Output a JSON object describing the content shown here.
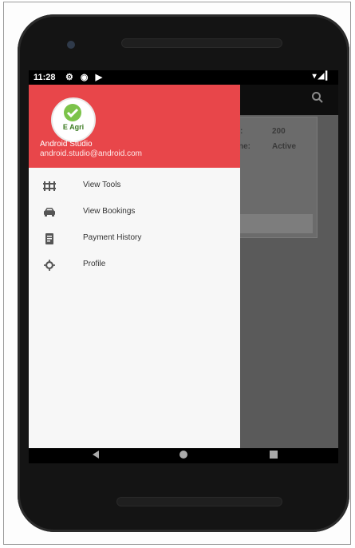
{
  "status_bar": {
    "time": "11:28",
    "left_icons": "⚙ ◉ ▶",
    "right_icons": "▾◢▎"
  },
  "toolbar": {
    "search_icon": "search-icon"
  },
  "background_card": {
    "row1_value": "200",
    "row2_label": "ne:",
    "row2_value": "Active",
    "row1_label": ":"
  },
  "drawer": {
    "logo_text": "E Agri",
    "user_name": "Android Studio",
    "user_email": "android.studio@android.com",
    "items": [
      {
        "label": "View Tools",
        "icon": "tools-grid-icon"
      },
      {
        "label": "View Bookings",
        "icon": "car-icon"
      },
      {
        "label": "Payment History",
        "icon": "receipt-icon"
      },
      {
        "label": "Profile",
        "icon": "gear-icon"
      }
    ]
  },
  "nav_bar": {
    "back_icon": "back-triangle-icon",
    "home_icon": "home-circle-icon",
    "recents_icon": "recents-square-icon"
  },
  "colors": {
    "drawer_header": "#e8464a",
    "phone_body": "#141414",
    "scrim": "#5a5a5a"
  }
}
